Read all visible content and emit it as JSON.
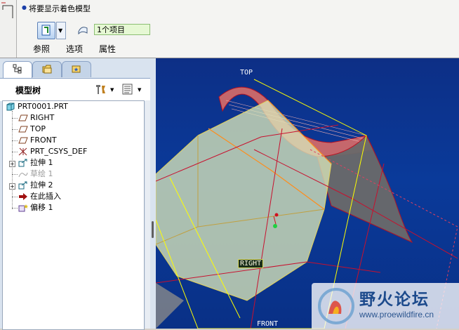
{
  "dashboard": {
    "prompt": "将要显示着色模型",
    "reference_value": "1个项目",
    "tabs": [
      "参照",
      "选项",
      "属性"
    ]
  },
  "model_tree": {
    "title": "模型树",
    "nodes": [
      {
        "label": "PRT0001.PRT",
        "icon": "part-icon"
      },
      {
        "label": "RIGHT",
        "icon": "datum-plane-icon"
      },
      {
        "label": "TOP",
        "icon": "datum-plane-icon"
      },
      {
        "label": "FRONT",
        "icon": "datum-plane-icon"
      },
      {
        "label": "PRT_CSYS_DEF",
        "icon": "coordinate-system-icon"
      },
      {
        "label": "拉伸 1",
        "icon": "extrude-icon"
      },
      {
        "label": "草绘 1",
        "icon": "sketch-icon",
        "dim": true
      },
      {
        "label": "拉伸 2",
        "icon": "extrude-icon"
      },
      {
        "label": "在此插入",
        "icon": "insert-here-icon"
      },
      {
        "label": "偏移 1",
        "icon": "offset-icon"
      }
    ]
  },
  "viewport": {
    "datum_labels": {
      "top": "TOP",
      "right": "RIGHT",
      "front": "FRONT"
    },
    "colors": {
      "background": "#0a3a9a",
      "datum": "#ffff00",
      "edge": "#c8102e",
      "surface": "#d8e6b8"
    }
  },
  "watermark": {
    "title": "野火论坛",
    "url": "www.proewildfire.cn"
  }
}
